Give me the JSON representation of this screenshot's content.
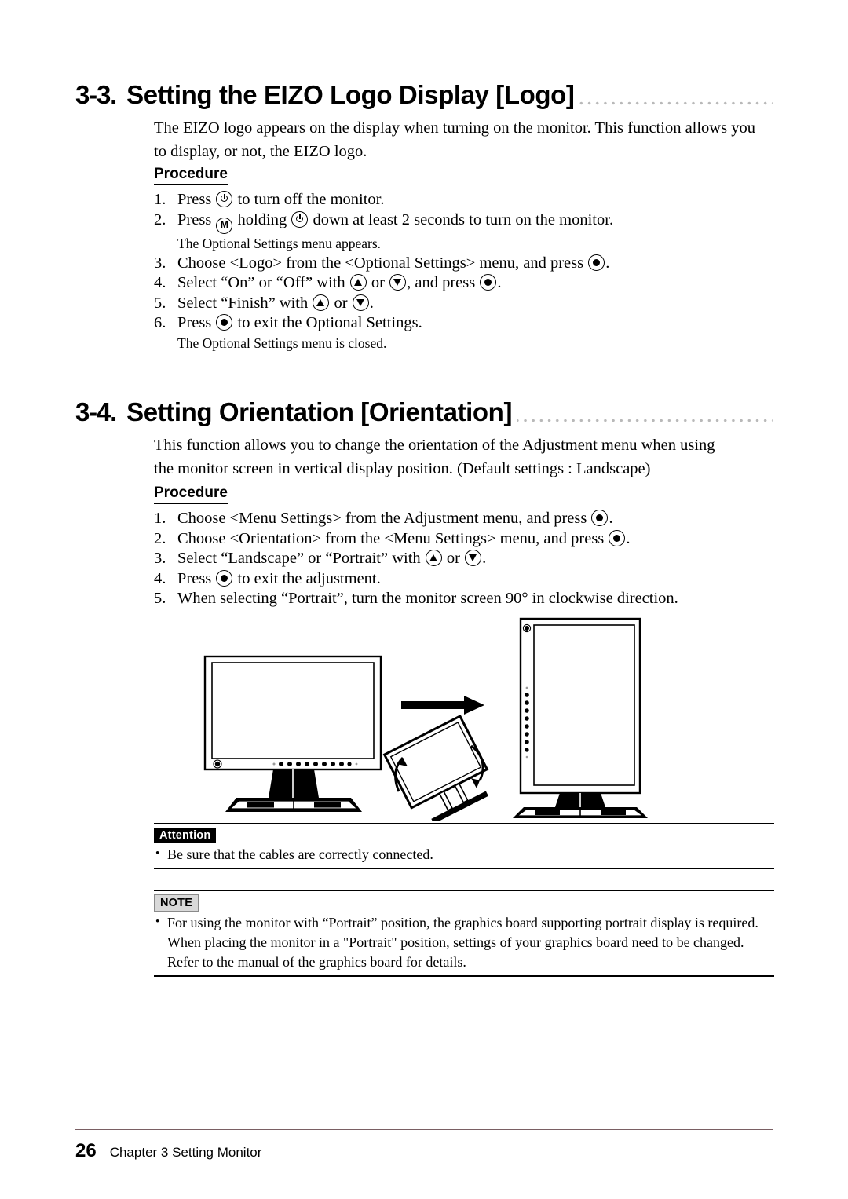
{
  "sections": [
    {
      "number": "3-3.",
      "title": "Setting the EIZO Logo Display [Logo]",
      "intro": "The EIZO logo appears on the display when turning on the monitor. This function allows you to display, or not, the EIZO logo.",
      "procedure_label": "Procedure",
      "steps": [
        {
          "num": "1.",
          "parts": [
            "Press ",
            "{power}",
            " to turn off the monitor."
          ]
        },
        {
          "num": "2.",
          "parts": [
            "Press ",
            "{m}",
            " holding ",
            "{power}",
            " down at least 2 seconds to turn on the monitor."
          ]
        },
        {
          "note": "The Optional Settings menu appears."
        },
        {
          "num": "3.",
          "parts": [
            "Choose <Logo> from the <Optional Settings> menu, and press ",
            "{dot}",
            "."
          ]
        },
        {
          "num": "4.",
          "parts": [
            "Select “On” or “Off” with ",
            "{up}",
            " or ",
            "{down}",
            ", and press ",
            "{dot}",
            "."
          ]
        },
        {
          "num": "5.",
          "parts": [
            "Select “Finish” with ",
            "{up}",
            " or ",
            "{down}",
            "."
          ]
        },
        {
          "num": "6.",
          "parts": [
            "Press ",
            "{dot}",
            " to exit the Optional Settings."
          ]
        },
        {
          "note": "The Optional Settings menu is closed."
        }
      ]
    },
    {
      "number": "3-4.",
      "title": "Setting Orientation [Orientation]",
      "intro": "This function allows you to change the orientation of the Adjustment menu when using the monitor screen in vertical display position. (Default settings : Landscape)",
      "procedure_label": "Procedure",
      "steps": [
        {
          "num": "1.",
          "parts": [
            "Choose <Menu Settings> from the Adjustment menu, and press ",
            "{dot}",
            "."
          ]
        },
        {
          "num": "2.",
          "parts": [
            "Choose <Orientation> from the <Menu Settings> menu, and press ",
            "{dot}",
            "."
          ]
        },
        {
          "num": "3.",
          "parts": [
            "Select “Landscape” or “Portrait” with ",
            "{up}",
            " or ",
            "{down}",
            "."
          ]
        },
        {
          "num": "4.",
          "parts": [
            "Press ",
            "{dot}",
            " to exit the adjustment."
          ]
        },
        {
          "num": "5.",
          "parts": [
            "When selecting “Portrait”, turn the monitor screen 90° in clockwise direction."
          ]
        }
      ]
    }
  ],
  "illustration": {
    "description": "Landscape monitor rotating 90 degrees clockwise into portrait monitor",
    "left_monitor": "landscape-monitor",
    "middle": "rotation-arrow-and-tilted-monitor",
    "right_monitor": "portrait-monitor"
  },
  "attention": {
    "label": "Attention",
    "items": [
      "Be sure that the cables are correctly connected."
    ]
  },
  "note": {
    "label": "NOTE",
    "items": [
      "For using the monitor with “Portrait” position, the graphics board supporting portrait display is required. When placing the monitor in a \"Portrait\" position, settings of your graphics board need to be changed. Refer to the manual of the graphics board for details."
    ]
  },
  "footer": {
    "page_number": "26",
    "chapter": "Chapter 3  Setting Monitor",
    "rule_color": "#7a5f63"
  }
}
